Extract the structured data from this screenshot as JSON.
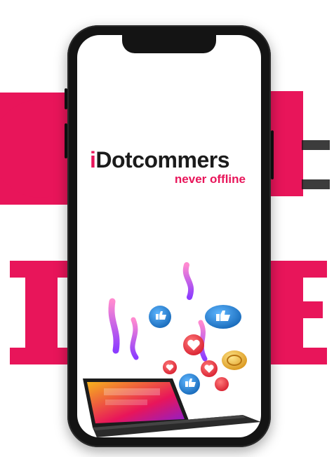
{
  "brand": {
    "name_prefix": "i",
    "name_rest": "Dotcommers",
    "tagline": "never offline"
  },
  "background_words": {
    "line1": "ONLINE",
    "line2": "ISE"
  },
  "colors": {
    "accent": "#e8155a",
    "text_dark": "#1b1b1b",
    "phone_body": "#141414",
    "like_blue": "#1e7fd8",
    "heart_red": "#ef3b3b",
    "coin_gold": "#f0b31e"
  },
  "icons": [
    "like-icon",
    "heart-icon",
    "coin-icon",
    "laptop-icon"
  ]
}
